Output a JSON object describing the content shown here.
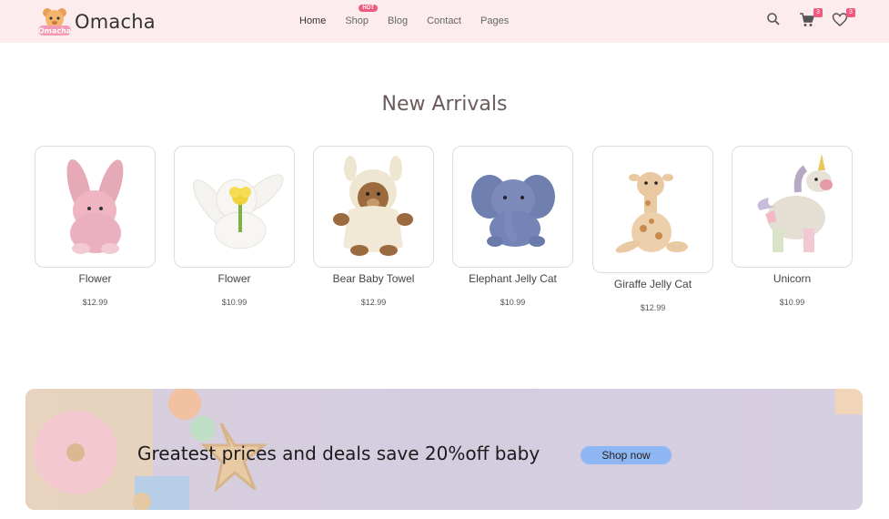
{
  "brand": {
    "name": "Omacha",
    "logo_text": "Omacha"
  },
  "nav": {
    "items": [
      {
        "label": "Home"
      },
      {
        "label": "Shop",
        "badge": "HOT"
      },
      {
        "label": "Blog"
      },
      {
        "label": "Contact"
      },
      {
        "label": "Pages"
      }
    ]
  },
  "header_icons": {
    "search": "search-icon",
    "cart": {
      "icon": "cart-icon",
      "count": "3"
    },
    "wishlist": {
      "icon": "heart-icon",
      "count": "3"
    }
  },
  "section": {
    "title": "New Arrivals"
  },
  "products": [
    {
      "name": "Flower",
      "price": "$12.99",
      "image": "pink-bunny-plush"
    },
    {
      "name": "Flower",
      "price": "$10.99",
      "image": "white-bunny-plush"
    },
    {
      "name": "Bear Baby Towel",
      "price": "$12.99",
      "image": "bear-towel-plush"
    },
    {
      "name": "Elephant Jelly Cat",
      "price": "$10.99",
      "image": "elephant-plush"
    },
    {
      "name": "Giraffe Jelly Cat",
      "price": "$12.99",
      "image": "giraffe-plush"
    },
    {
      "name": "Unicorn",
      "price": "$10.99",
      "image": "unicorn-plush"
    }
  ],
  "banner": {
    "text": "Greatest prices and deals save 20%off baby",
    "button_label": "Shop now"
  },
  "colors": {
    "header_bg": "#fdecee",
    "accent": "#f05a7e",
    "button": "#8eb6f2"
  }
}
